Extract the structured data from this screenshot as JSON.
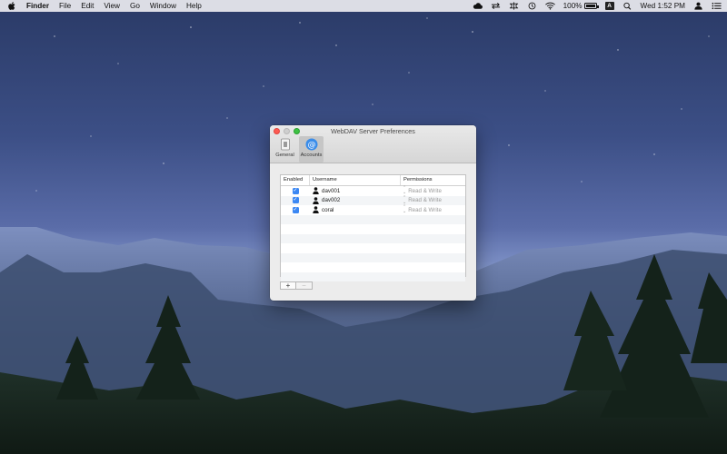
{
  "menubar": {
    "items": [
      "Finder",
      "File",
      "Edit",
      "View",
      "Go",
      "Window",
      "Help"
    ],
    "battery": "100%",
    "input_source": "A",
    "clock": "Wed 1:52 PM"
  },
  "window": {
    "title": "WebDAV Server Preferences",
    "toolbar": [
      {
        "label": "General",
        "icon": "general-icon"
      },
      {
        "label": "Accounts",
        "icon": "at-sign-icon"
      }
    ],
    "table": {
      "headers": [
        "Enabled",
        "Username",
        "Permissions"
      ],
      "rows": [
        {
          "enabled": true,
          "username": "dav001",
          "permissions": "Read & Write"
        },
        {
          "enabled": true,
          "username": "dav002",
          "permissions": "Read & Write"
        },
        {
          "enabled": true,
          "username": "coral",
          "permissions": "Read & Write"
        }
      ]
    },
    "buttons": {
      "add": "+",
      "remove": "−"
    }
  },
  "colors": {
    "accent": "#3b87f3",
    "close": "#fd5b53",
    "zoom": "#3ec244"
  }
}
